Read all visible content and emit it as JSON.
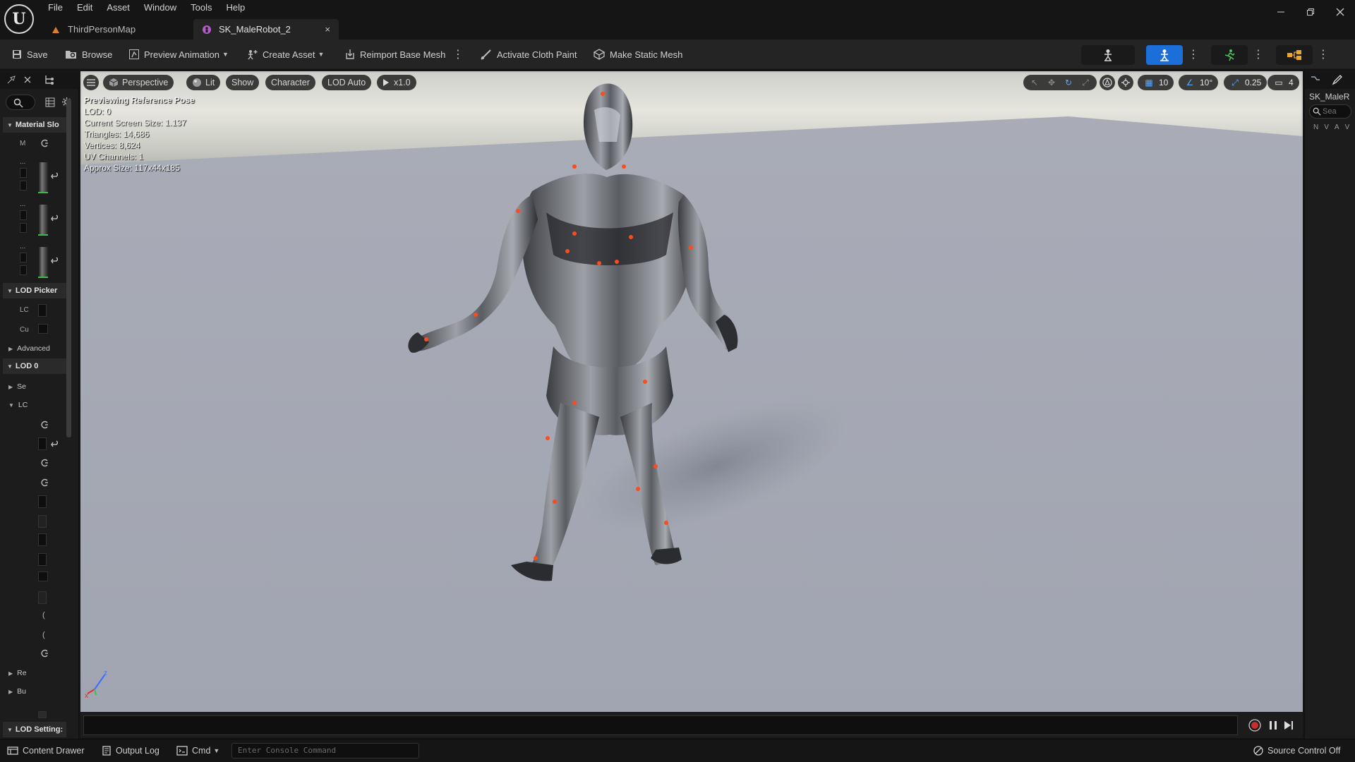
{
  "app": {
    "logo_letter": "U"
  },
  "menu": [
    "File",
    "Edit",
    "Asset",
    "Window",
    "Tools",
    "Help"
  ],
  "tabs": [
    {
      "label": "ThirdPersonMap",
      "icon": "level-icon"
    },
    {
      "label": "SK_MaleRobot_2",
      "icon": "skeletal-mesh-icon",
      "active": true,
      "close": "×"
    }
  ],
  "toolbar": {
    "save": "Save",
    "browse": "Browse",
    "preview_animation": "Preview Animation",
    "create_asset": "Create Asset",
    "reimport": "Reimport Base Mesh",
    "cloth_paint": "Activate Cloth Paint",
    "static_mesh": "Make Static Mesh"
  },
  "left_panel": {
    "sections": {
      "material_slots": "Material Slo",
      "lod_picker": "LOD Picker",
      "advanced": "Advanced",
      "lod0": "LOD 0",
      "lod_settings": "LOD Setting:"
    },
    "rows": {
      "m": "M",
      "lc": "LC",
      "cu": "Cu",
      "se": "Se",
      "lc2": "LC",
      "re": "Re",
      "bu": "Bu",
      "dash": "..."
    }
  },
  "viewport": {
    "toolbar": {
      "perspective": "Perspective",
      "lit": "Lit",
      "show": "Show",
      "character": "Character",
      "lod": "LOD Auto",
      "play_rate": "x1.0",
      "grid_snap": "10",
      "rot_snap": "10°",
      "scale_snap": "0.25",
      "cam_speed": "4"
    },
    "stats": {
      "headline": "Previewing Reference Pose",
      "lod": "LOD: 0",
      "screen_size": "Current Screen Size: 1.137",
      "triangles": "Triangles: 14,686",
      "vertices": "Vertices: 8,624",
      "uv_channels": "UV Channels: 1",
      "approx_size": "Approx Size: 117x44x185"
    },
    "gizmo": {
      "x": "x",
      "z": "z"
    }
  },
  "right_panel": {
    "title": "SK_MaleR",
    "search_placeholder": "Sea",
    "cols": [
      "N",
      "V",
      "A",
      "V"
    ]
  },
  "status_bar": {
    "content_drawer": "Content Drawer",
    "output_log": "Output Log",
    "cmd": "Cmd",
    "console_placeholder": "Enter Console Command",
    "source_control": "Source Control Off"
  },
  "colors": {
    "accent_blue": "#1c6fd8",
    "emissive_orange": "#ff4a1c",
    "green_mark": "#3cba4c"
  }
}
